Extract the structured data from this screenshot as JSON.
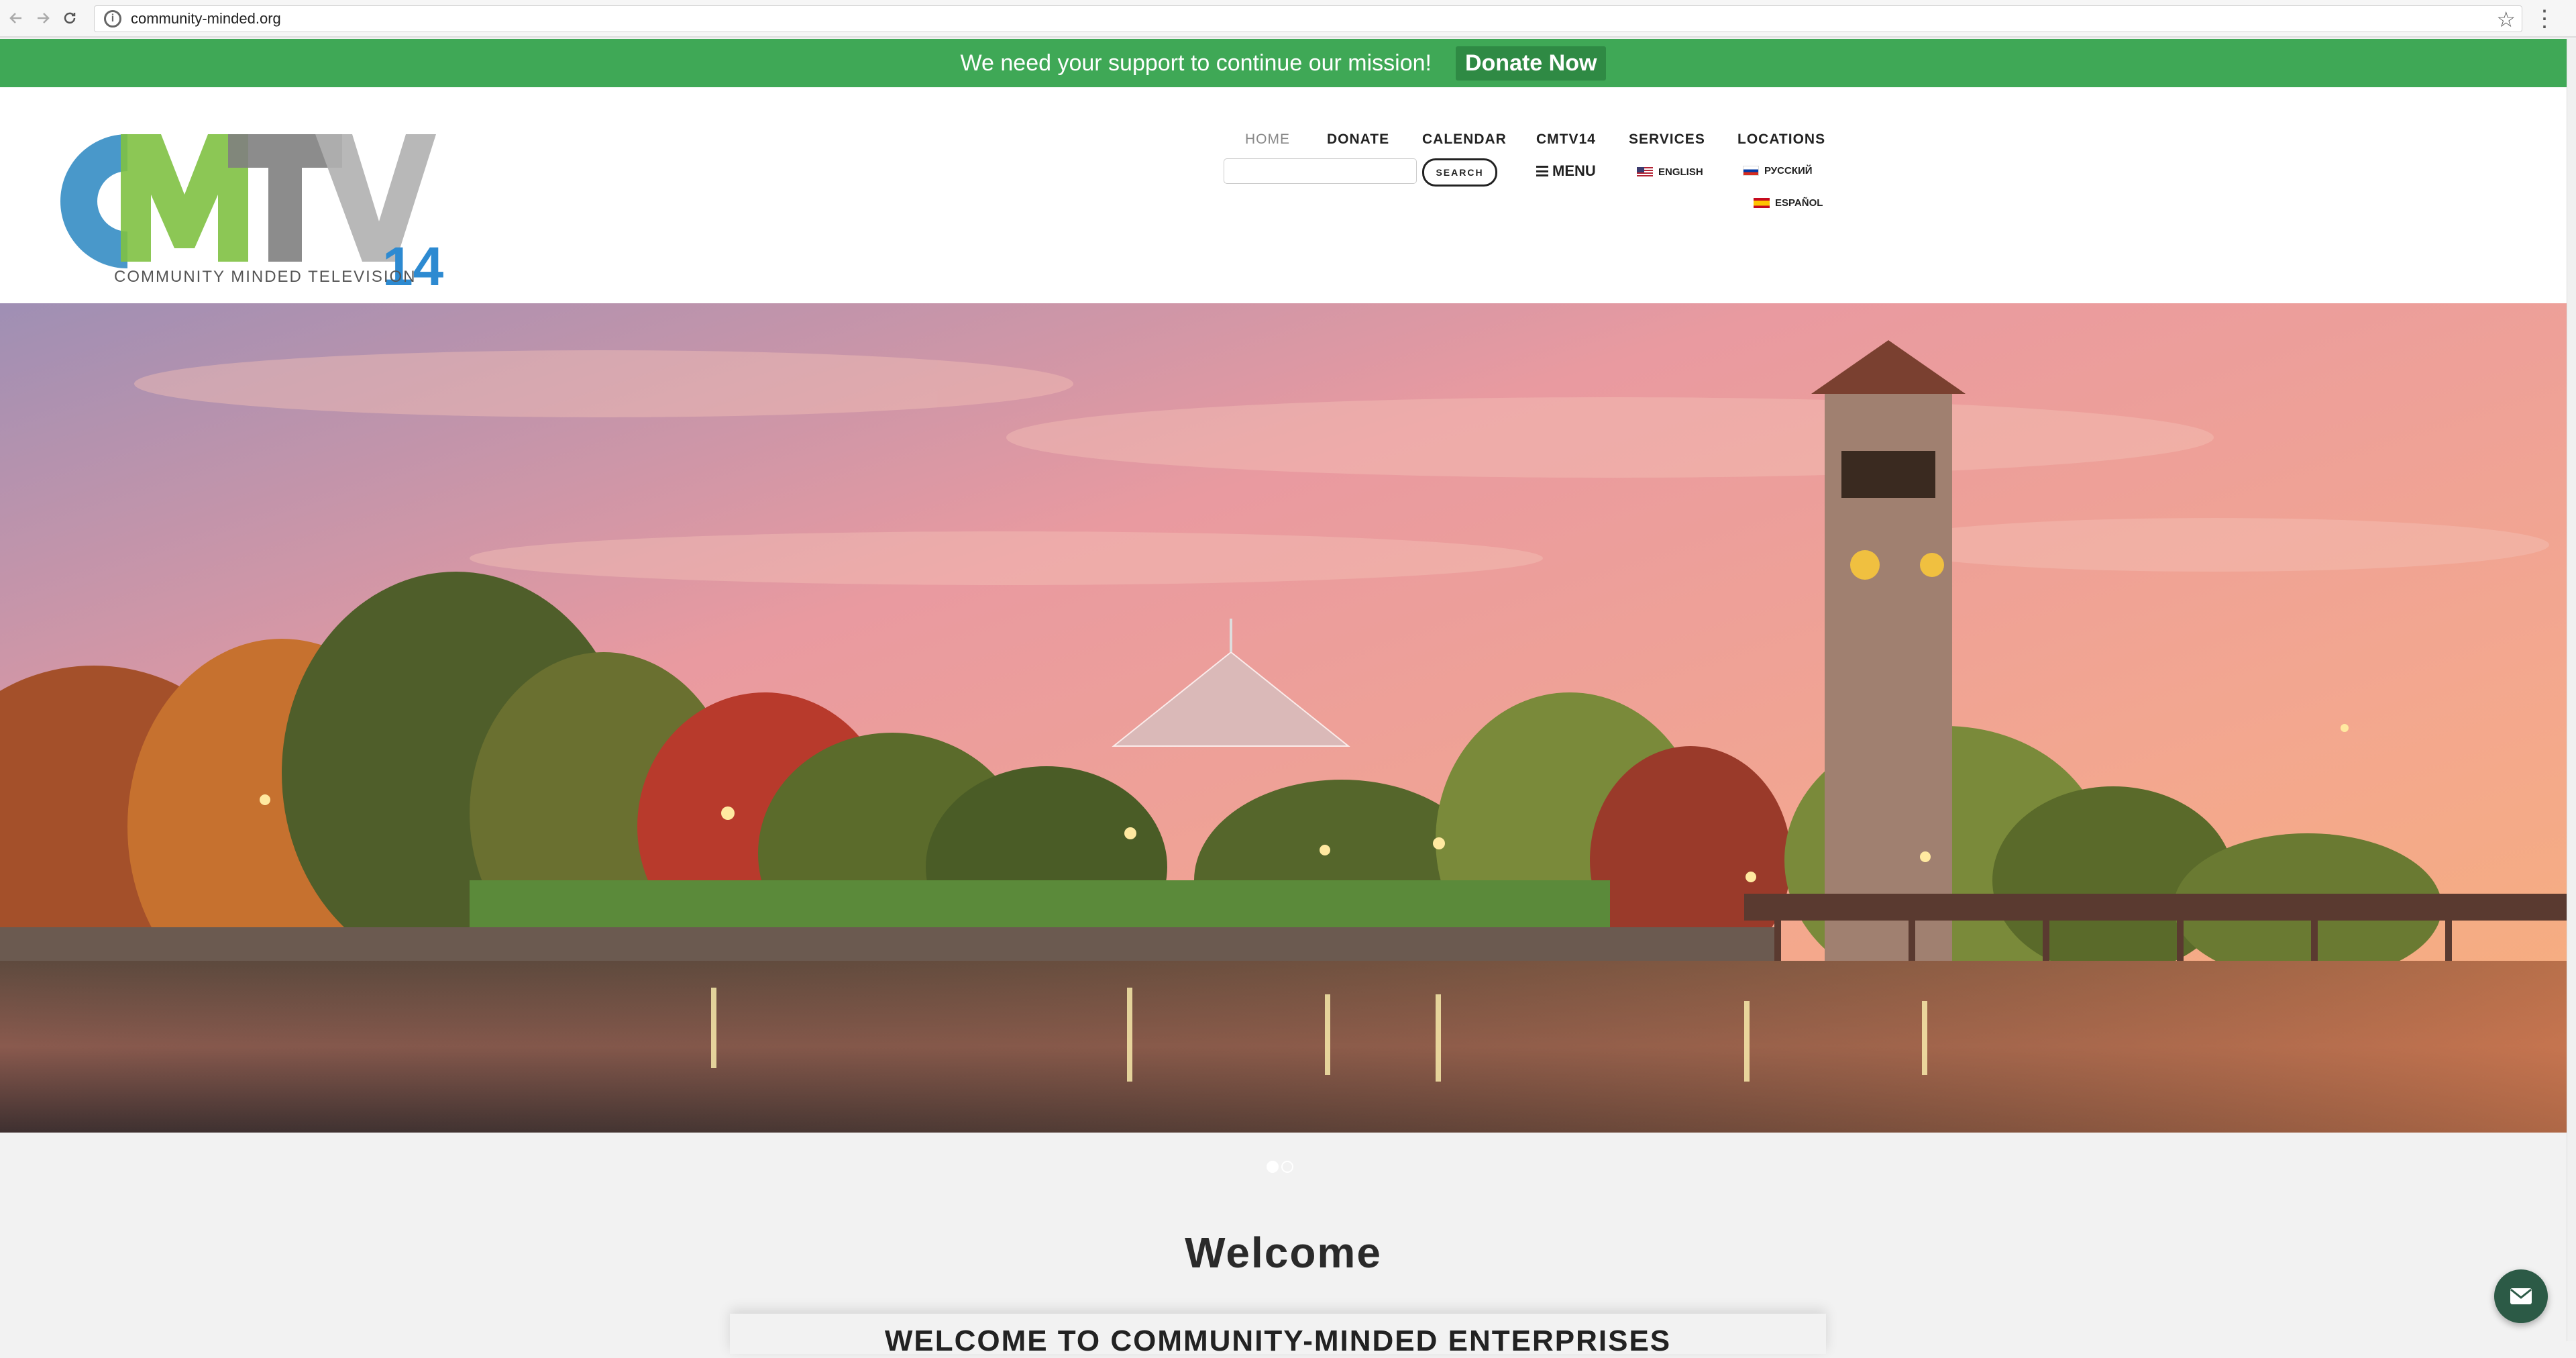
{
  "browser": {
    "url": "community-minded.org",
    "back_icon": "arrow-left-icon",
    "forward_icon": "arrow-right-icon",
    "reload_icon": "reload-icon",
    "star_icon": "star-icon",
    "menu_icon": "kebab-icon"
  },
  "banner": {
    "text": "We need your support to continue our mission!",
    "button_label": "Donate Now",
    "background": "#3fa856"
  },
  "logo": {
    "letters": "CMTV",
    "number": "14",
    "tagline": "COMMUNITY MINDED TELEVISION",
    "colors": {
      "c": "#3a8fc6",
      "m": "#7fc142",
      "t": "#808080",
      "v": "#b0b0b0",
      "num": "#2d8ad1"
    }
  },
  "nav": {
    "items": [
      {
        "label": "HOME",
        "active": true
      },
      {
        "label": "DONATE"
      },
      {
        "label": "CALENDAR"
      },
      {
        "label": "CMTV14"
      },
      {
        "label": "SERVICES"
      },
      {
        "label": "LOCATIONS"
      }
    ],
    "search_placeholder": "",
    "search_button": "SEARCH",
    "menu_label": "MENU",
    "languages": [
      {
        "label": "ENGLISH",
        "flag": "us-flag-icon"
      },
      {
        "label": "РУССКИЙ",
        "flag": "ru-flag-icon"
      },
      {
        "label": "ESPAÑOL",
        "flag": "es-flag-icon"
      }
    ]
  },
  "slider": {
    "slides": 2,
    "active_index": 0
  },
  "main": {
    "welcome_title": "Welcome",
    "card_title": "WELCOME TO COMMUNITY-MINDED ENTERPRISES"
  },
  "chat_icon": "envelope-icon"
}
